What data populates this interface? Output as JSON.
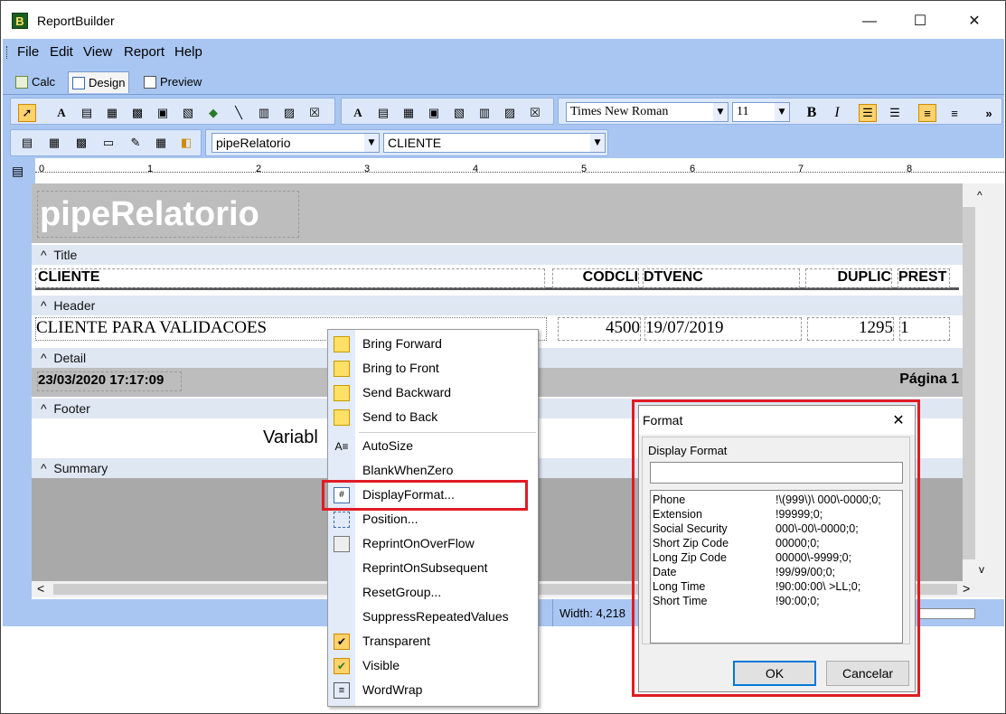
{
  "window": {
    "title": "ReportBuilder",
    "logo_letter": "B",
    "minimize": "—",
    "maximize": "☐",
    "close": "✕"
  },
  "menu": [
    "File",
    "Edit",
    "View",
    "Report",
    "Help"
  ],
  "tabs": [
    "Calc",
    "Design",
    "Preview"
  ],
  "toolbar": {
    "font_name": "Times New Roman",
    "font_size": "11",
    "bold": "B",
    "italic": "I",
    "more": "»"
  },
  "toolbar2": {
    "pipeline": "pipeRelatorio",
    "field": "CLIENTE"
  },
  "ruler": [
    "0",
    "1",
    "2",
    "3",
    "4",
    "5",
    "6",
    "7",
    "8"
  ],
  "bands": {
    "title_text": "pipeRelatorio",
    "title_label": "Title",
    "header_label": "Header",
    "detail_label": "Detail",
    "footer_label": "Footer",
    "summary_label": "Summary",
    "header_fields": [
      "CLIENTE",
      "CODCLI",
      "DTVENC",
      "DUPLIC",
      "PREST"
    ],
    "detail_fields": [
      "CLIENTE PARA VALIDACOES",
      "4500",
      "19/07/2019",
      "1295",
      "1"
    ],
    "footer_datetime": "23/03/2020 17:17:09",
    "footer_page": "Página 1",
    "summary_var": "Variabl"
  },
  "status": {
    "width_text": "Width: 4,218"
  },
  "context_menu": [
    {
      "label": "Bring Forward",
      "icon": "bring-forward-icon"
    },
    {
      "label": "Bring to Front",
      "icon": "bring-to-front-icon"
    },
    {
      "label": "Send Backward",
      "icon": "send-backward-icon"
    },
    {
      "label": "Send to Back",
      "icon": "send-to-back-icon"
    },
    {
      "label": "AutoSize",
      "icon": "autosize-icon"
    },
    {
      "label": "BlankWhenZero",
      "icon": ""
    },
    {
      "label": "DisplayFormat...",
      "icon": "display-format-icon"
    },
    {
      "label": "Position...",
      "icon": "position-icon"
    },
    {
      "label": "ReprintOnOverFlow",
      "icon": "reprint-icon"
    },
    {
      "label": "ReprintOnSubsequent",
      "icon": ""
    },
    {
      "label": "ResetGroup...",
      "icon": ""
    },
    {
      "label": "SuppressRepeatedValues",
      "icon": ""
    },
    {
      "label": "Transparent",
      "icon": "check-icon",
      "checked": true
    },
    {
      "label": "Visible",
      "icon": "visible-check-icon",
      "checked": true
    },
    {
      "label": "WordWrap",
      "icon": "wordwrap-icon"
    }
  ],
  "format_dialog": {
    "title": "Format",
    "group_label": "Display Format",
    "input_value": "",
    "formats": [
      {
        "name": "Phone",
        "value": "!\\(999\\)\\ 000\\-0000;0;"
      },
      {
        "name": "Extension",
        "value": "!99999;0;"
      },
      {
        "name": "Social Security",
        "value": "000\\-00\\-0000;0;"
      },
      {
        "name": "Short Zip Code",
        "value": "00000;0;"
      },
      {
        "name": "Long Zip Code",
        "value": "00000\\-9999;0;"
      },
      {
        "name": "Date",
        "value": "!99/99/00;0;"
      },
      {
        "name": "Long Time",
        "value": "!90:00:00\\ >LL;0;"
      },
      {
        "name": "Short Time",
        "value": "!90:00;0;"
      }
    ],
    "ok": "OK",
    "cancel": "Cancelar"
  }
}
